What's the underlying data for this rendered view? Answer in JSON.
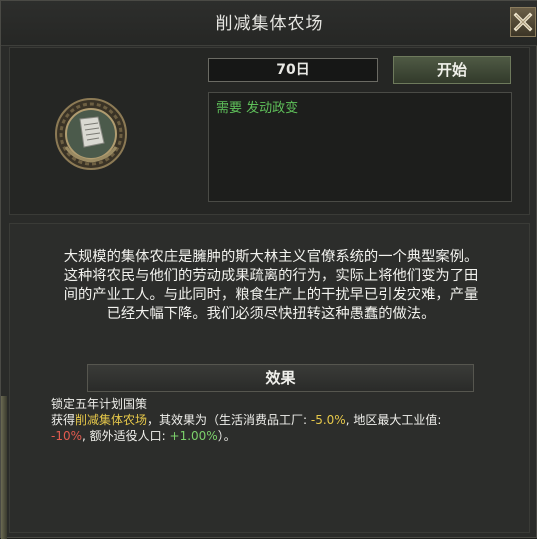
{
  "window": {
    "title": "削减集体农场"
  },
  "decision": {
    "duration": "70日",
    "start_label": "开始",
    "requirement": "需要 发动政变",
    "icon": "document-medal-icon"
  },
  "description": {
    "lines": [
      "大规模的集体农庄是臃肿的斯大林主义官僚系统的一个典型案例。",
      "这种将农民与他们的劳动成果疏离的行为，实际上将他们变为了田",
      "间的产业工人。与此同时，粮食生产上的干扰早已引发灾难，产量",
      "已经大幅下降。我们必须尽快扭转这种愚蠢的做法。"
    ]
  },
  "effects": {
    "header": "效果",
    "line1": "锁定五年计划国策",
    "line2_prefix": "获得",
    "line2_name": "削减集体农场",
    "line2_mid": "，其效果为（生活消费品工厂: ",
    "consumer_goods": "-5.0%",
    "line2_suffix": ", 地区最大工业值:",
    "industry_cap": "-10%",
    "line3_mid": ", 额外适役人口: ",
    "recruitable_pop": "+1.00%",
    "line3_suffix": "）。"
  },
  "colors": {
    "accent_green": "#5fc05a",
    "highlight_yellow": "#e6c84a",
    "negative_red": "#e25b4f",
    "positive_green": "#7cd16b"
  }
}
